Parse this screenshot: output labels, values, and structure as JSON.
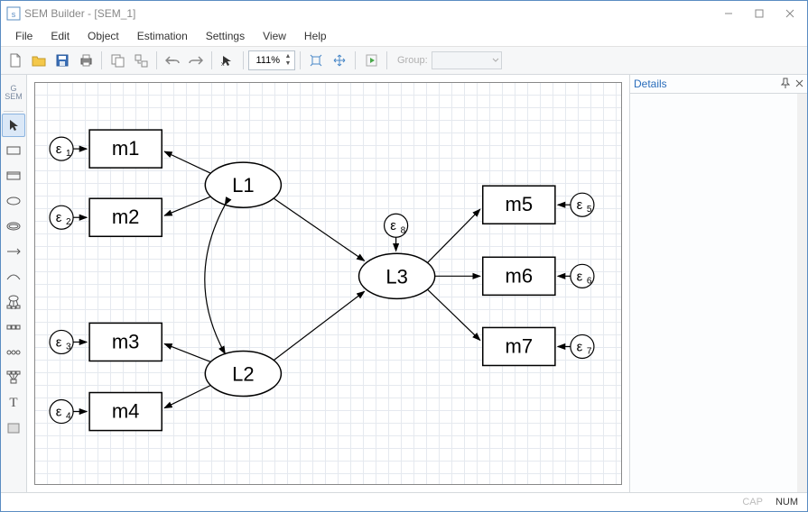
{
  "window": {
    "title": "SEM Builder - [SEM_1]"
  },
  "menu": {
    "file": "File",
    "edit": "Edit",
    "object": "Object",
    "estimation": "Estimation",
    "settings": "Settings",
    "view": "View",
    "help": "Help"
  },
  "toolbar": {
    "zoom": "111%",
    "group_label": "Group:"
  },
  "details": {
    "title": "Details"
  },
  "status": {
    "cap": "CAP",
    "num": "NUM"
  },
  "diagram": {
    "boxes": {
      "m1": "m1",
      "m2": "m2",
      "m3": "m3",
      "m4": "m4",
      "m5": "m5",
      "m6": "m6",
      "m7": "m7"
    },
    "latent": {
      "L1": "L1",
      "L2": "L2",
      "L3": "L3"
    },
    "eps": {
      "e1": "ε",
      "e1s": "1",
      "e2": "ε",
      "e2s": "2",
      "e3": "ε",
      "e3s": "3",
      "e4": "ε",
      "e4s": "4",
      "e5": "ε",
      "e5s": "5",
      "e6": "ε",
      "e6s": "6",
      "e7": "ε",
      "e7s": "7",
      "e8": "ε",
      "e8s": "8"
    }
  }
}
